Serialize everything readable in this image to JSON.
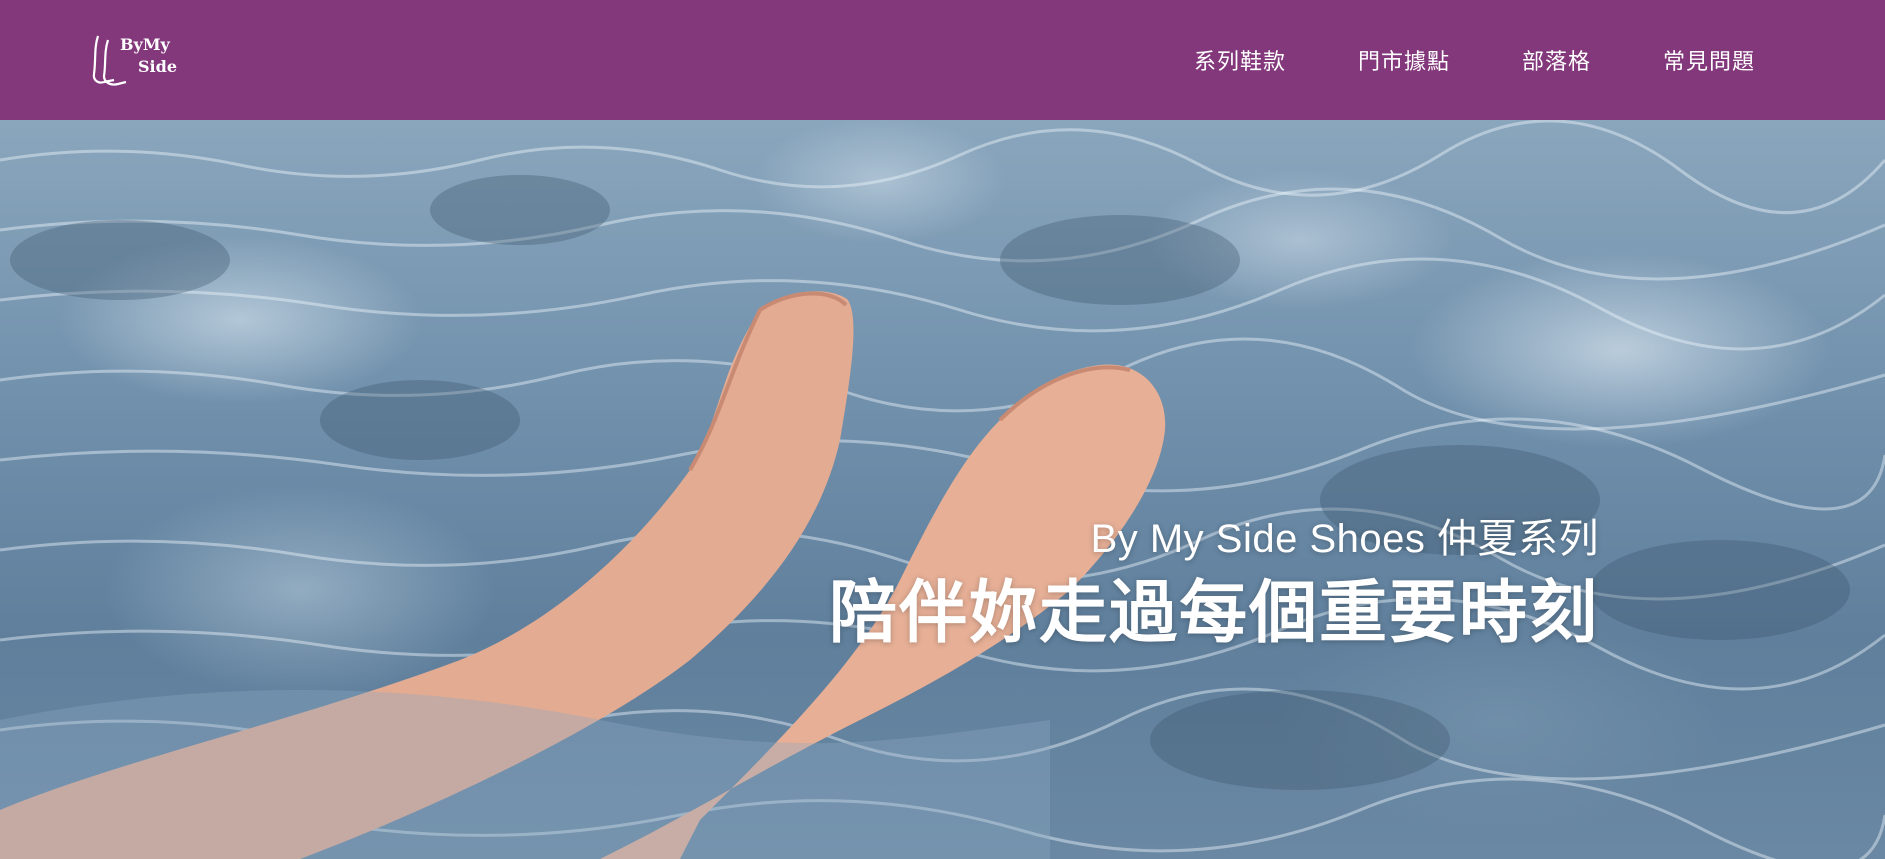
{
  "brand": {
    "logo_line1": "ByMy",
    "logo_line2": "Side",
    "icon": "feet-logo-icon"
  },
  "nav": {
    "items": [
      {
        "label": "系列鞋款"
      },
      {
        "label": "門市據點"
      },
      {
        "label": "部落格"
      },
      {
        "label": "常見問題"
      }
    ]
  },
  "hero": {
    "subtitle": "By My Side Shoes 仲夏系列",
    "title": "陪伴妳走過每個重要時刻"
  },
  "colors": {
    "navbar": "#83387c",
    "text": "#ffffff"
  }
}
